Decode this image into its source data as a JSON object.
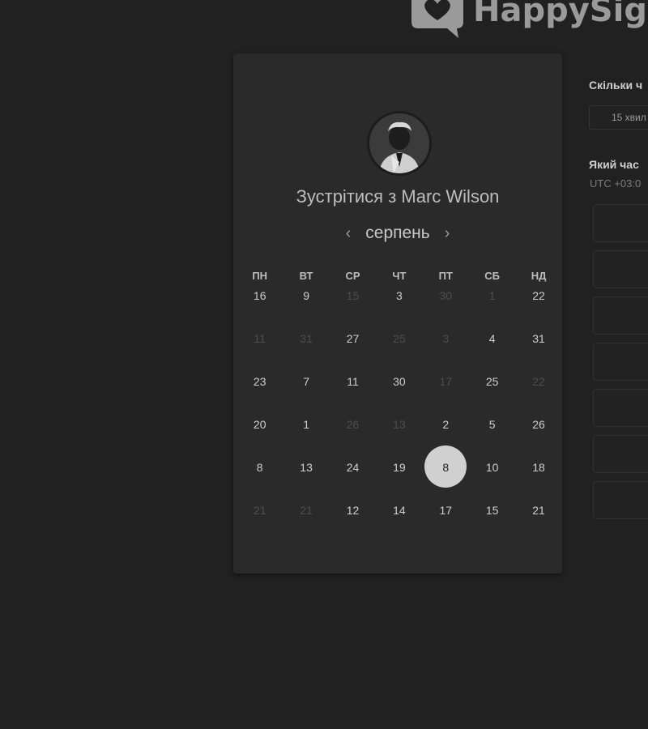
{
  "brand": {
    "logo_text": "HappySig",
    "logo_icon": "heart-speech-bubble-icon"
  },
  "calendar": {
    "title": "Зустрітися з Marc Wilson",
    "avatar_icon": "user-avatar",
    "month": "серпень",
    "prev_icon": "chevron-left-icon",
    "next_icon": "chevron-right-icon",
    "weekdays": [
      "ПН",
      "ВТ",
      "СР",
      "ЧТ",
      "ПТ",
      "СБ",
      "НД"
    ],
    "weeks": [
      [
        {
          "d": "16",
          "muted": false
        },
        {
          "d": "9",
          "muted": false
        },
        {
          "d": "15",
          "muted": true
        },
        {
          "d": "3",
          "muted": false
        },
        {
          "d": "30",
          "muted": true
        },
        {
          "d": "1",
          "muted": true
        },
        {
          "d": "22",
          "muted": false
        }
      ],
      [
        {
          "d": "11",
          "muted": true
        },
        {
          "d": "31",
          "muted": true
        },
        {
          "d": "27",
          "muted": false
        },
        {
          "d": "25",
          "muted": true
        },
        {
          "d": "3",
          "muted": true
        },
        {
          "d": "4",
          "muted": false
        },
        {
          "d": "31",
          "muted": false
        }
      ],
      [
        {
          "d": "23",
          "muted": false
        },
        {
          "d": "7",
          "muted": false
        },
        {
          "d": "11",
          "muted": false
        },
        {
          "d": "30",
          "muted": false
        },
        {
          "d": "17",
          "muted": true
        },
        {
          "d": "25",
          "muted": false
        },
        {
          "d": "22",
          "muted": true
        }
      ],
      [
        {
          "d": "20",
          "muted": false
        },
        {
          "d": "1",
          "muted": false
        },
        {
          "d": "26",
          "muted": true
        },
        {
          "d": "13",
          "muted": true
        },
        {
          "d": "2",
          "muted": false
        },
        {
          "d": "5",
          "muted": false
        },
        {
          "d": "26",
          "muted": false
        }
      ],
      [
        {
          "d": "8",
          "muted": false
        },
        {
          "d": "13",
          "muted": false
        },
        {
          "d": "24",
          "muted": false
        },
        {
          "d": "19",
          "muted": false
        },
        {
          "d": "8",
          "muted": false,
          "selected": true
        },
        {
          "d": "10",
          "muted": false
        },
        {
          "d": "18",
          "muted": false
        }
      ],
      [
        {
          "d": "21",
          "muted": true
        },
        {
          "d": "21",
          "muted": true
        },
        {
          "d": "12",
          "muted": false
        },
        {
          "d": "14",
          "muted": false
        },
        {
          "d": "17",
          "muted": false
        },
        {
          "d": "15",
          "muted": false
        },
        {
          "d": "21",
          "muted": false
        }
      ]
    ]
  },
  "booking": {
    "duration_question": "Скільки ч",
    "duration_value": "15 хвил",
    "time_question": "Який час",
    "timezone": "UTC +03:0",
    "slots": [
      "",
      "",
      "",
      "",
      "",
      "",
      ""
    ]
  },
  "colors": {
    "background": "#212121",
    "card": "#2a2a2a",
    "selected_day": "#d0d0d0"
  }
}
